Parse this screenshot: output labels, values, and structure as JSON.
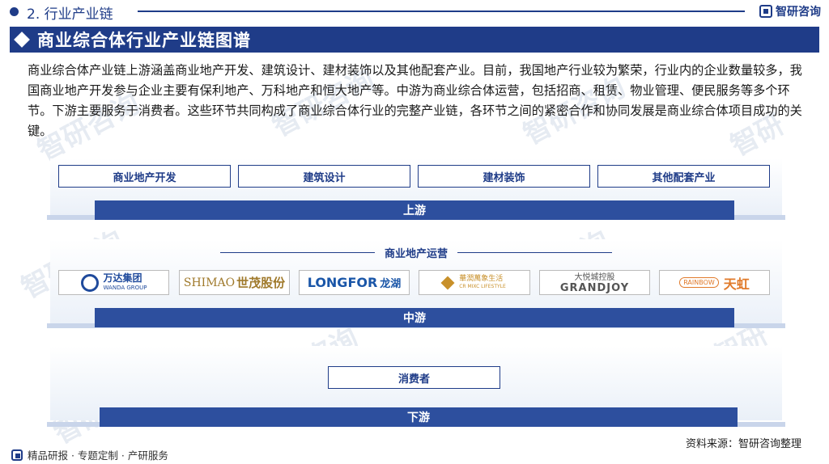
{
  "header": {
    "section_label": "2. 行业产业链",
    "brand": "智研咨询"
  },
  "title": "商业综合体行业产业链图谱",
  "description": "商业综合体产业链上游涵盖商业地产开发、建筑设计、建材装饰以及其他配套产业。目前，我国地产行业较为繁荣，行业内的企业数量较多，我国商业地产开发参与企业主要有保利地产、万科地产和恒大地产等。中游为商业综合体运营，包括招商、租赁、物业管理、便民服务等多个环节。下游主要服务于消费者。这些环节共同构成了商业综合体行业的完整产业链，各环节之间的紧密合作和协同发展是商业综合体项目成功的关键。",
  "upstream": {
    "items": [
      "商业地产开发",
      "建筑设计",
      "建材装饰",
      "其他配套产业"
    ],
    "stage_label": "上游"
  },
  "midstream": {
    "subtitle": "商业地产运营",
    "logos": [
      {
        "line1": "万达集团",
        "line2": "WANDA GROUP",
        "color": "#1f4a9c"
      },
      {
        "line1": "SHIMAO",
        "line2": "世茂股份",
        "color": "#a07a2c"
      },
      {
        "line1": "LONGFOR",
        "line2": "龙湖",
        "color": "#1a56a8"
      },
      {
        "line1": "華潤萬象生活",
        "line2": "CR MIXC LIFESTYLE",
        "color": "#c8902a"
      },
      {
        "line1": "大悦城控股",
        "line2": "GRANDJOY",
        "color": "#555555"
      },
      {
        "line1": "RAINBOW",
        "line2": "天虹",
        "color": "#e07a2a"
      }
    ],
    "stage_label": "中游"
  },
  "downstream": {
    "items": [
      "消费者"
    ],
    "stage_label": "下游"
  },
  "footer": {
    "left": "精品研报 · 专题定制 · 产研服务",
    "source": "资料来源：智研咨询整理"
  },
  "colors": {
    "primary": "#1f3c88",
    "stage": "#2d4f9e"
  }
}
